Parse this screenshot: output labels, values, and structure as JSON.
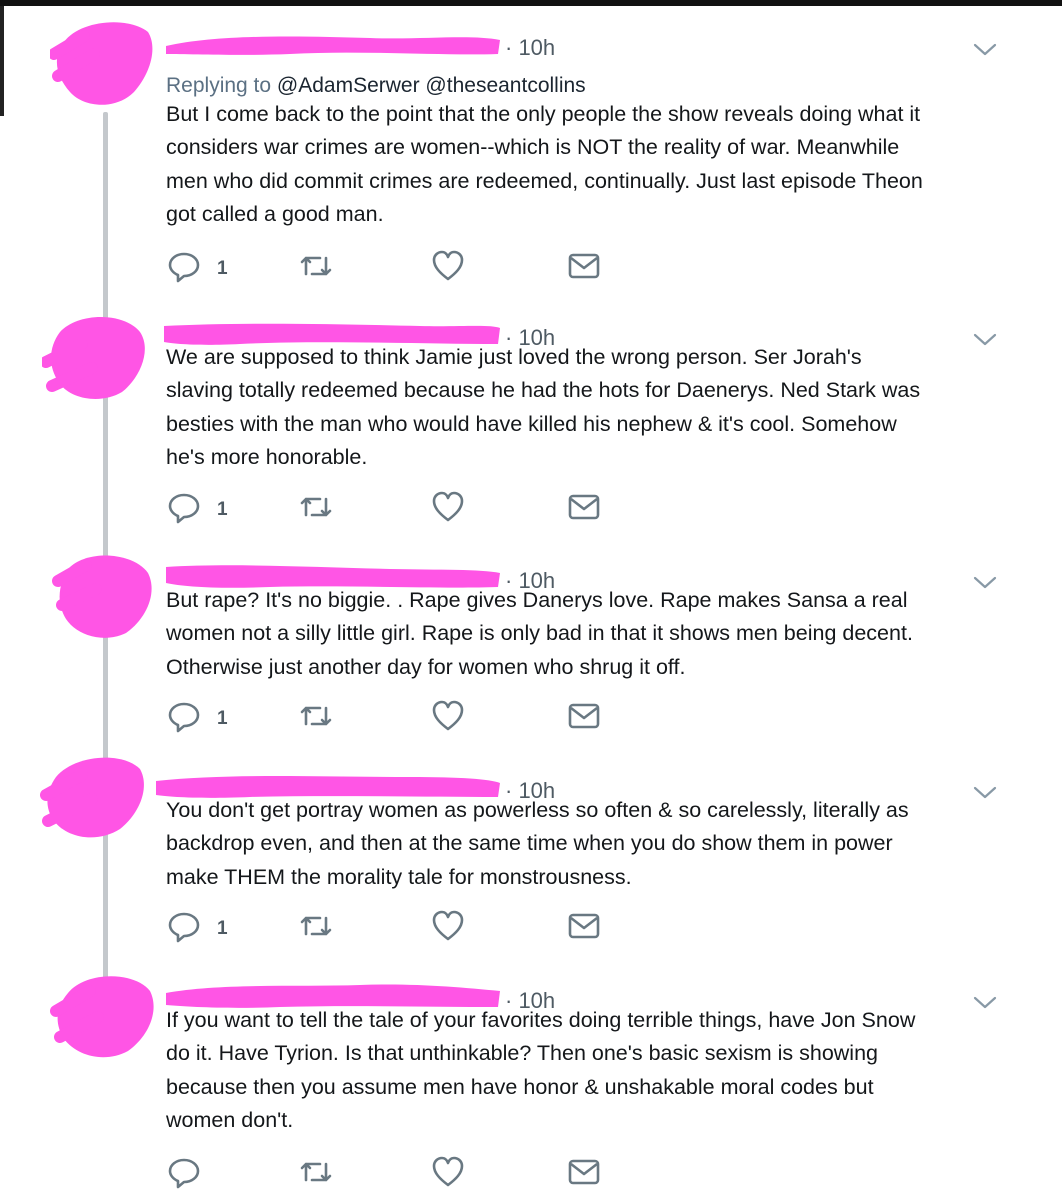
{
  "thread": {
    "tweets": [
      {
        "time": "· 10h",
        "replying_label": "Replying to",
        "replying_handles": "@AdamSerwer @theseantcollins",
        "text": "But I come back to the point that the only people the show reveals doing what it\nconsiders war crimes are women--which is NOT the reality of war. Meanwhile\nmen who did commit crimes are redeemed, continually. Just last episode Theon\ngot called a good man.",
        "reply_count": "1"
      },
      {
        "time": "· 10h",
        "text": "We are supposed to think Jamie just loved the wrong person. Ser Jorah's\nslaving totally redeemed because he had the hots for Daenerys. Ned Stark was\nbesties with the man who would have killed his nephew & it's cool. Somehow\nhe's more honorable.",
        "reply_count": "1"
      },
      {
        "time": "· 10h",
        "text": "But rape? It's no biggie. . Rape gives Danerys love. Rape makes Sansa a real\nwomen not a silly little girl. Rape is only bad in that it shows men being decent.\nOtherwise just another day for women who shrug it off.",
        "reply_count": "1"
      },
      {
        "time": "· 10h",
        "text": "You don't get portray women as powerless so often & so carelessly, literally as\nbackdrop even, and then at the same time when you do show them in power\nmake THEM the morality tale for monstrousness.",
        "reply_count": "1"
      },
      {
        "time": "· 10h",
        "text": "If you want to tell the tale of your favorites doing terrible things, have Jon Snow\ndo it. Have Tyrion. Is that unthinkable? Then one's basic sexism is showing\nbecause then you assume men have honor & unshakable moral codes but\nwomen don't.",
        "reply_count": ""
      }
    ]
  },
  "icons": {
    "reply": "reply-icon",
    "retweet": "retweet-icon",
    "like": "heart-icon",
    "dm": "envelope-icon",
    "more": "chevron-down-icon"
  },
  "colors": {
    "redaction": "#ff55e5",
    "icon_gray": "#697882",
    "text": "#14171a",
    "meta_gray": "#5b7083",
    "thread_line": "#c4c8cc"
  }
}
